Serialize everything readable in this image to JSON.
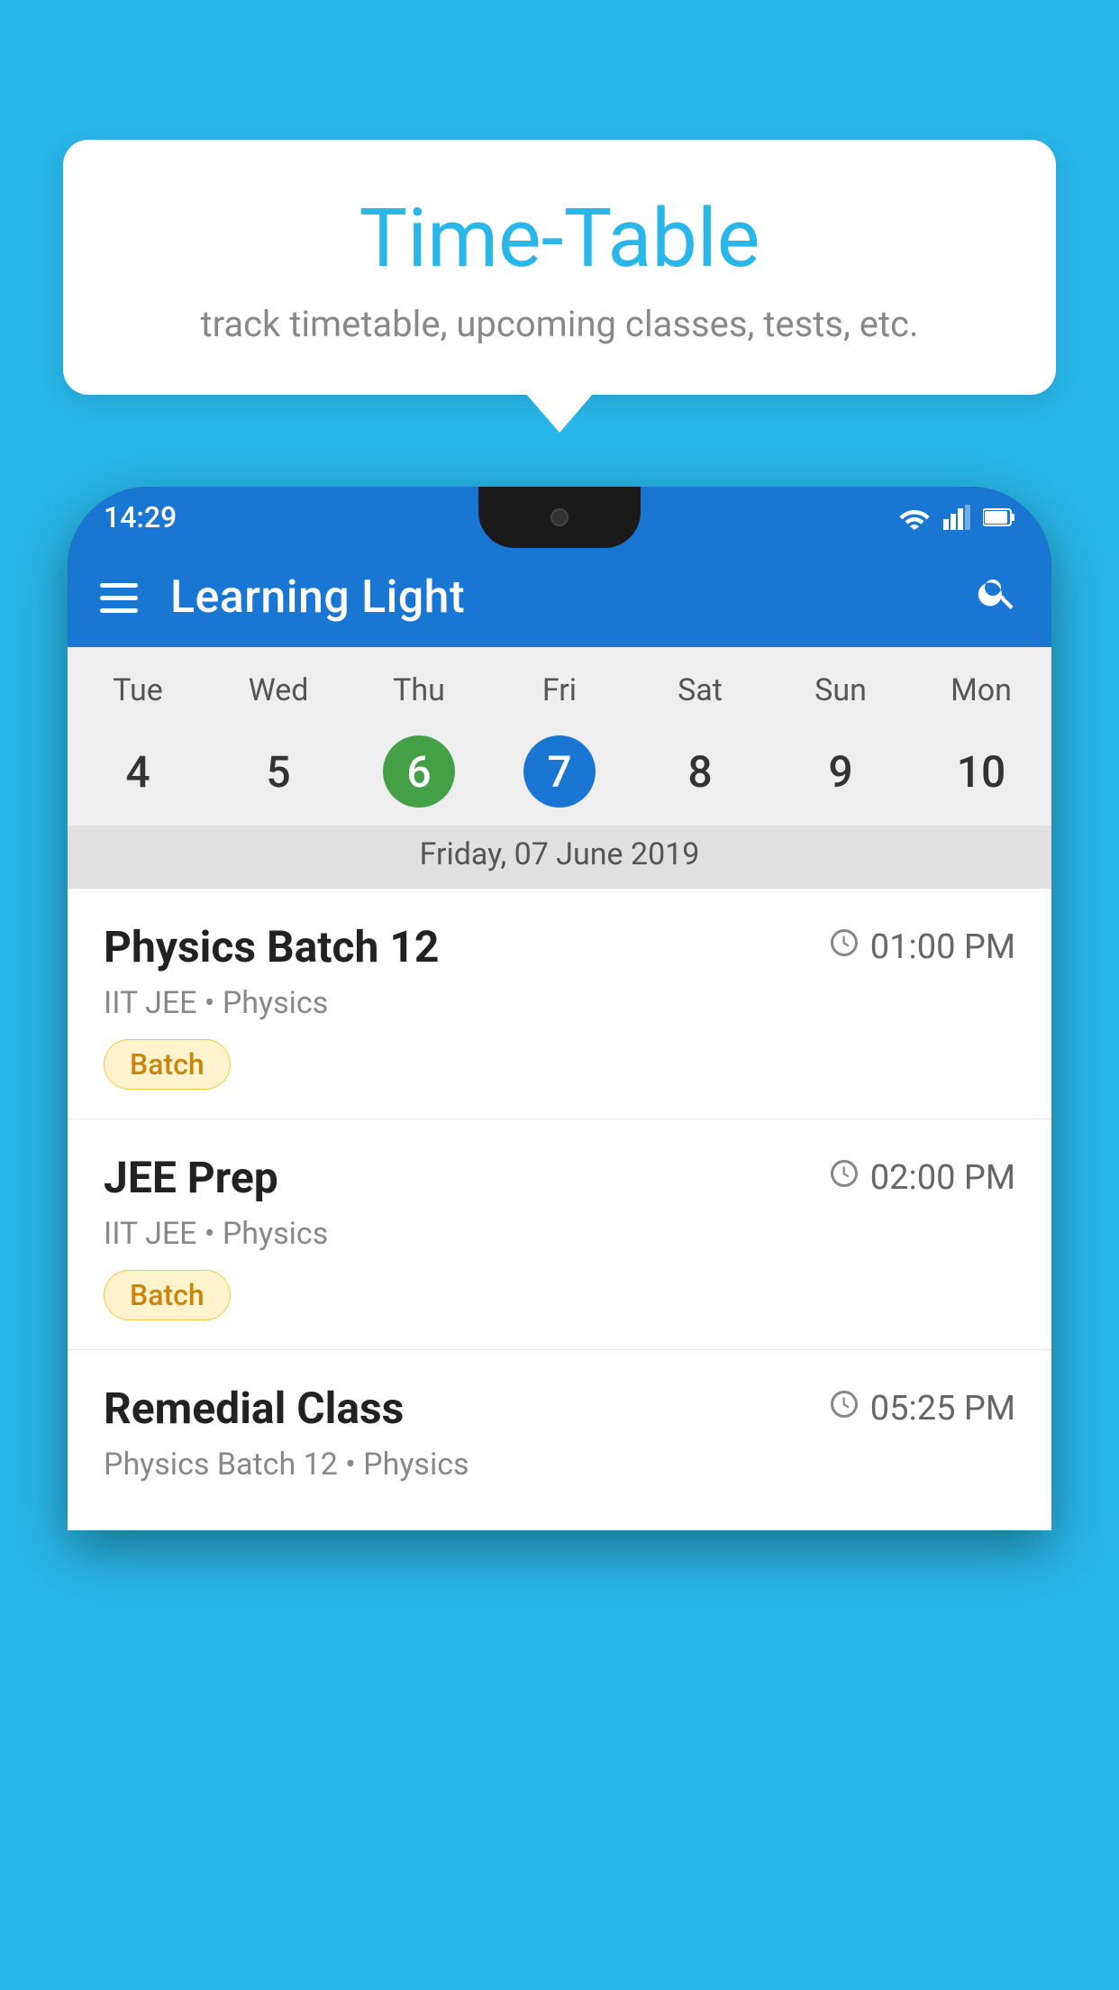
{
  "background_color": "#29B6E8",
  "tooltip": {
    "title": "Time-Table",
    "subtitle": "track timetable, upcoming classes, tests, etc."
  },
  "app": {
    "title": "Learning Light",
    "menu_label": "Menu",
    "search_label": "Search"
  },
  "status_bar": {
    "time": "14:29"
  },
  "calendar": {
    "days": [
      "Tue",
      "Wed",
      "Thu",
      "Fri",
      "Sat",
      "Sun",
      "Mon"
    ],
    "dates": [
      "4",
      "5",
      "6",
      "7",
      "8",
      "9",
      "10"
    ],
    "today_index": 2,
    "selected_index": 3,
    "selected_label": "Friday, 07 June 2019"
  },
  "schedule": [
    {
      "title": "Physics Batch 12",
      "time": "01:00 PM",
      "subtitle": "IIT JEE • Physics",
      "badge": "Batch"
    },
    {
      "title": "JEE Prep",
      "time": "02:00 PM",
      "subtitle": "IIT JEE • Physics",
      "badge": "Batch"
    },
    {
      "title": "Remedial Class",
      "time": "05:25 PM",
      "subtitle": "Physics Batch 12 • Physics",
      "badge": null
    }
  ]
}
